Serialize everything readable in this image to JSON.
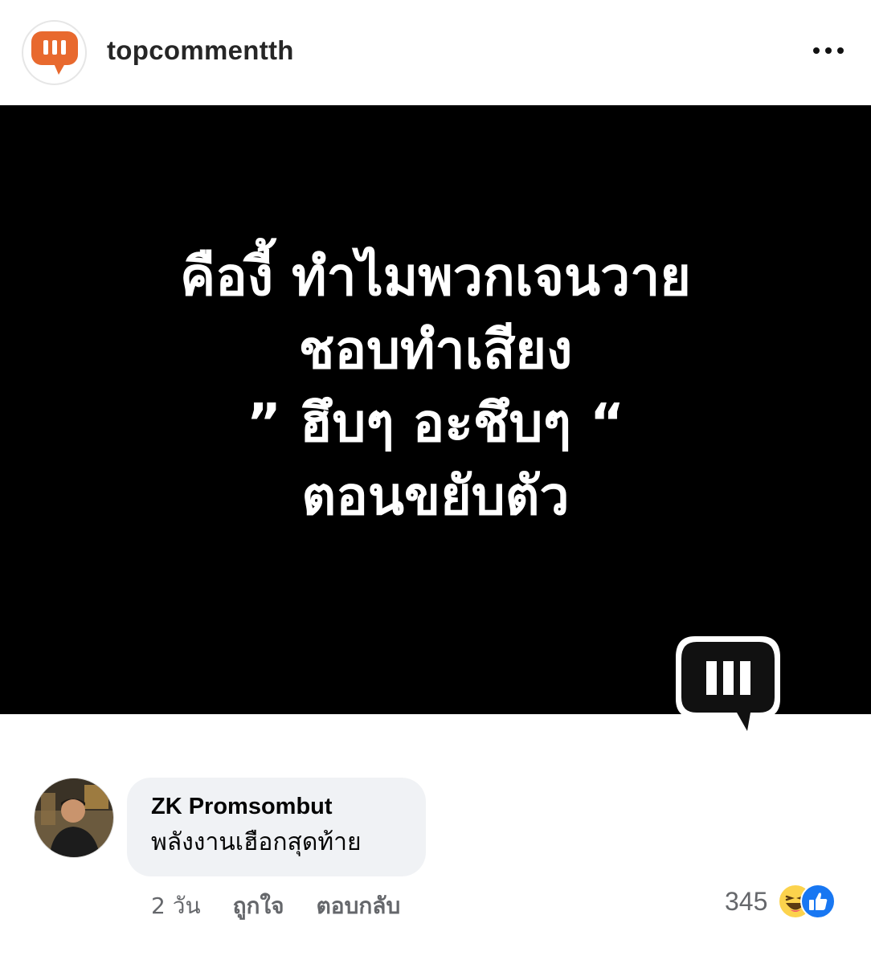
{
  "header": {
    "username": "topcommentth",
    "avatar_icon": "speech-bubble-logo-icon",
    "more_icon": "more-options-icon",
    "brand_color": "#e8692e"
  },
  "post": {
    "background": "#000000",
    "text_color": "#ffffff",
    "lines": [
      "คืองี้ ทำไมพวกเจนวาย",
      "ชอบทำเสียง",
      "” ฮึบๆ อะชึบๆ “",
      "ตอนขยับตัว"
    ],
    "watermark_icon": "speech-bubble-logo-icon"
  },
  "comment": {
    "author": "ZK Promsombut",
    "text": "พลังงานเฮือกสุดท้าย",
    "time": "2 วัน",
    "like_label": "ถูกใจ",
    "reply_label": "ตอบกลับ",
    "reaction_count": "345",
    "reaction_icons": [
      "haha-reaction-icon",
      "like-reaction-icon"
    ],
    "bubble_color": "#f0f2f5"
  }
}
